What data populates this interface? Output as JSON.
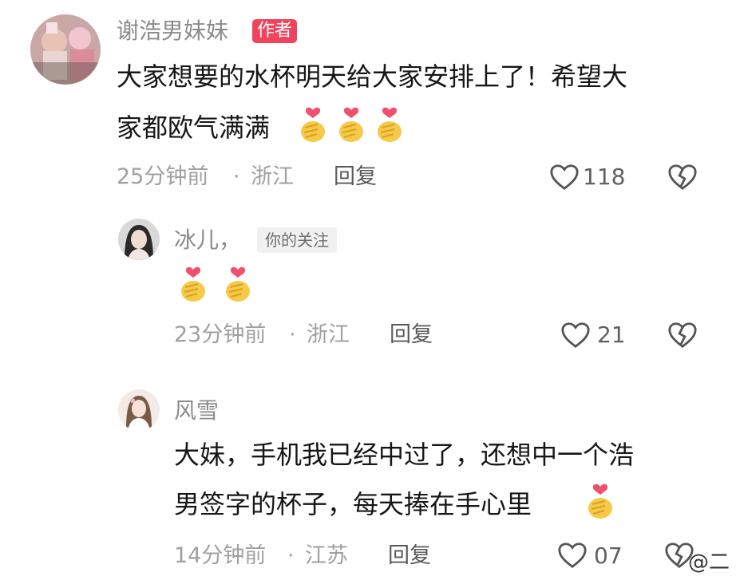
{
  "comments": [
    {
      "author": "谢浩男妹妹",
      "author_badge": "作者",
      "text_lines": [
        "大家想要的水杯明天给大家安排上了！希望大",
        "家都欧气满满"
      ],
      "time": "25分钟前",
      "location": "浙江",
      "reply_label": "回复",
      "likes": "118",
      "emoji_count": 3
    },
    {
      "author": "冰儿，",
      "author_badge": "你的关注",
      "text_lines": [],
      "time": "23分钟前",
      "location": "浙江",
      "reply_label": "回复",
      "likes": "21",
      "emoji_count": 2
    },
    {
      "author": "风雪",
      "text_lines": [
        "大妹，手机我已经中过了，还想中一个浩",
        "男签字的杯子，每天捧在手心里"
      ],
      "time": "14分钟前",
      "location": "江苏",
      "reply_label": "回复",
      "likes": "07",
      "emoji_count": 1
    }
  ],
  "separator": "·",
  "watermark": "@二",
  "icons": {
    "like": "heart-outline-icon",
    "dislike": "broken-heart-icon",
    "emoji": "finger-heart-emoji"
  },
  "colors": {
    "author_badge": "#f1435a",
    "meta_text": "#a0a0a0",
    "name_text": "#8b8b8b"
  }
}
